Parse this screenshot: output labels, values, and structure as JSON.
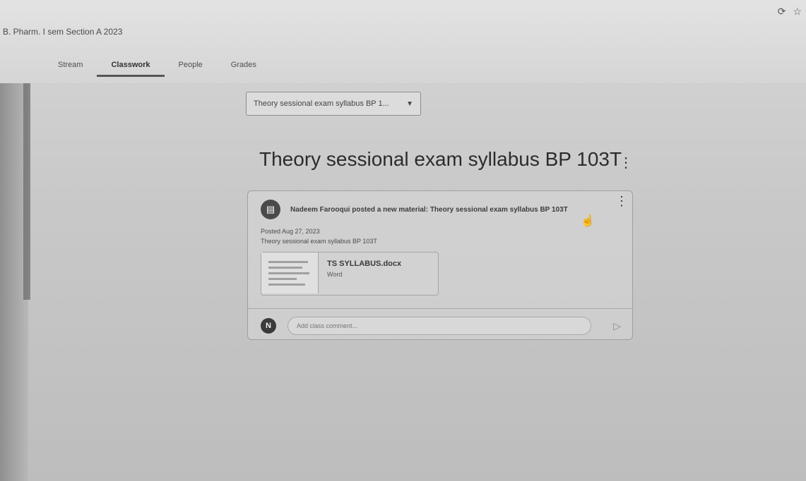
{
  "header": {
    "class_title": "B. Pharm. I sem Section A 2023",
    "icons": [
      "refresh-icon",
      "star-icon"
    ]
  },
  "tabs": [
    {
      "label": "Stream",
      "active": false
    },
    {
      "label": "Classwork",
      "active": true
    },
    {
      "label": "People",
      "active": false
    },
    {
      "label": "Grades",
      "active": false
    }
  ],
  "topic_filter": {
    "value": "Theory sessional exam syllabus BP 1..."
  },
  "topic": {
    "title": "Theory sessional exam syllabus BP 103T"
  },
  "post": {
    "title": "Nadeem Farooqui posted a new material: Theory sessional exam syllabus BP 103T",
    "posted": "Posted Aug 27, 2023",
    "description": "Theory sessional exam syllabus BP 103T",
    "attachment": {
      "name": "TS SYLLABUS.docx",
      "type": "Word"
    },
    "comment": {
      "avatar_letter": "N",
      "placeholder": "Add class comment..."
    }
  }
}
